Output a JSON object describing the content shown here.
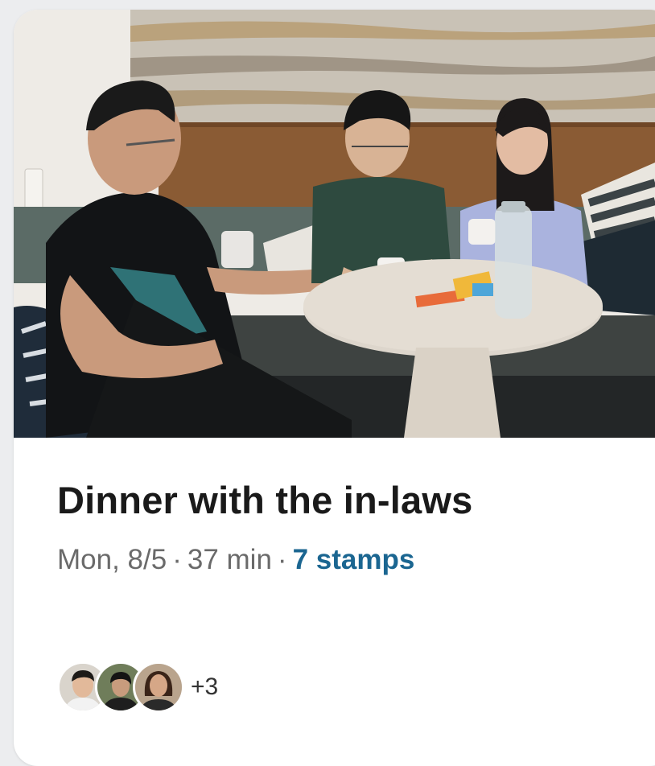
{
  "card": {
    "title": "Dinner with the in-laws",
    "date": "Mon, 8/5",
    "separator": "·",
    "duration": "37 min",
    "stamps": "7 stamps",
    "photo_icon": "group-photo-image",
    "participants": [
      {
        "avatar_icon": "person-avatar-icon"
      },
      {
        "avatar_icon": "person-avatar-icon"
      },
      {
        "avatar_icon": "person-avatar-icon"
      }
    ],
    "more_count": "+3"
  },
  "colors": {
    "background": "#ecedef",
    "card": "#ffffff",
    "title": "#1a1a1a",
    "meta": "#6a6a6a",
    "stamps": "#1b6691"
  }
}
